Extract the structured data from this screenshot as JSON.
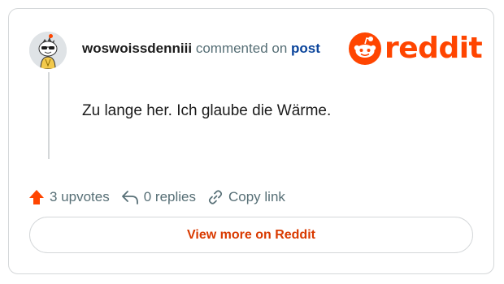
{
  "header": {
    "username": "woswoissdenniii",
    "commented_on": "commented on",
    "post_link": "post"
  },
  "logo": {
    "wordmark": "reddit"
  },
  "comment": {
    "text": "Zu lange her. Ich glaube die Wärme."
  },
  "actions": {
    "upvotes": "3 upvotes",
    "replies": "0 replies",
    "copy_link": "Copy link"
  },
  "footer": {
    "view_more": "View more on Reddit"
  },
  "colors": {
    "brand": "#ff4500",
    "button_text": "#d93a00",
    "link": "#0a449b",
    "muted_text": "#576f76"
  },
  "icons": {
    "avatar": "snoo-sunglasses-avatar",
    "upvote": "upvote-arrow-icon",
    "reply": "reply-arrow-icon",
    "copy": "link-icon",
    "logo": "reddit-snoo-icon"
  }
}
